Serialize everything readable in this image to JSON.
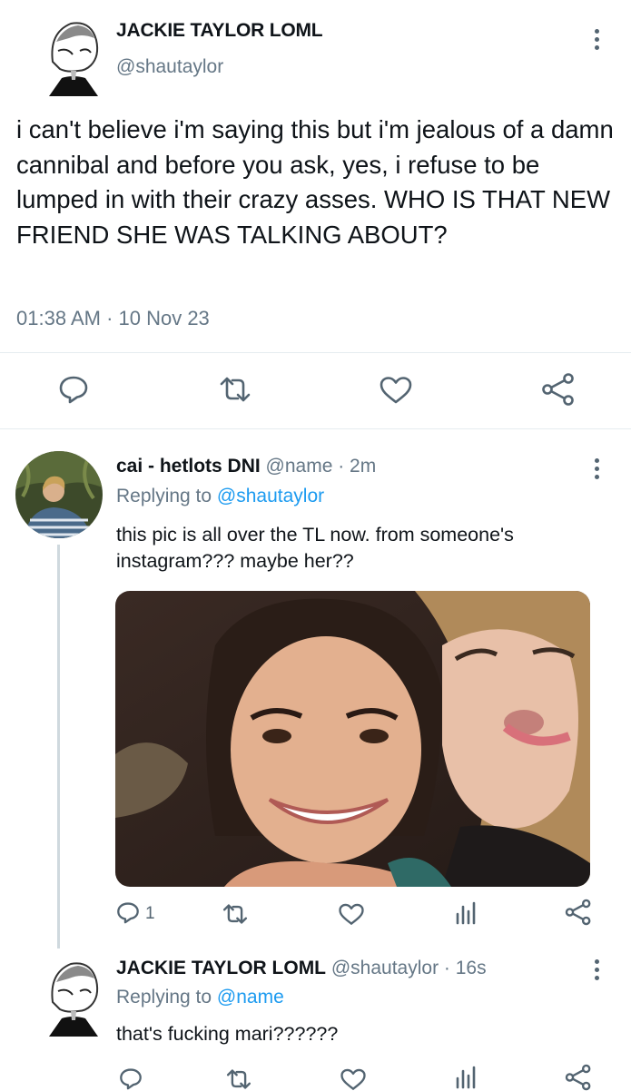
{
  "main_tweet": {
    "display_name": "JACKIE TAYLOR LOML",
    "handle": "@shautaylor",
    "text": "i can't believe i'm saying this but i'm jealous of a damn cannibal and before you ask, yes, i refuse to be lumped in with their crazy asses. WHO IS THAT NEW FRIEND SHE WAS TALKING ABOUT?",
    "timestamp": "01:38 AM · 10 Nov 23",
    "actions": [
      "reply-icon",
      "retweet-icon",
      "like-icon",
      "share-icon"
    ]
  },
  "reply_1": {
    "display_name": "cai - hetlots DNI",
    "handle_time": "@name · 2m",
    "replying_prefix": "Replying to",
    "replying_to": "@shautaylor",
    "text": "this pic is all over the TL now. from someone's instagram???  maybe her??",
    "reply_count": "1",
    "media": "photo of two women posing close together, one smiling, one sticking out her tongue"
  },
  "reply_2": {
    "display_name": "JACKIE TAYLOR LOML",
    "handle_time": "@shautaylor · 16s",
    "replying_prefix": "Replying to",
    "replying_to": "@name",
    "text": "that's fucking mari??????"
  },
  "colors": {
    "text": "#0f1419",
    "muted": "#657786",
    "link": "#1d9bf0",
    "icon": "#536471",
    "divider": "#e6ecf0"
  }
}
